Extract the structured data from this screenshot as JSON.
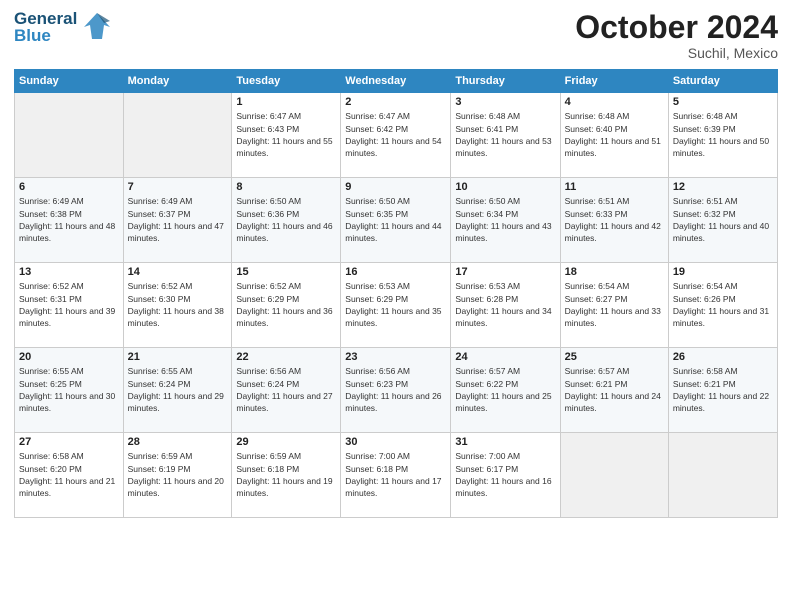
{
  "header": {
    "logo_line1": "General",
    "logo_line2": "Blue",
    "month": "October 2024",
    "location": "Suchil, Mexico"
  },
  "weekdays": [
    "Sunday",
    "Monday",
    "Tuesday",
    "Wednesday",
    "Thursday",
    "Friday",
    "Saturday"
  ],
  "weeks": [
    [
      {
        "day": "",
        "info": ""
      },
      {
        "day": "",
        "info": ""
      },
      {
        "day": "1",
        "info": "Sunrise: 6:47 AM\nSunset: 6:43 PM\nDaylight: 11 hours and 55 minutes."
      },
      {
        "day": "2",
        "info": "Sunrise: 6:47 AM\nSunset: 6:42 PM\nDaylight: 11 hours and 54 minutes."
      },
      {
        "day": "3",
        "info": "Sunrise: 6:48 AM\nSunset: 6:41 PM\nDaylight: 11 hours and 53 minutes."
      },
      {
        "day": "4",
        "info": "Sunrise: 6:48 AM\nSunset: 6:40 PM\nDaylight: 11 hours and 51 minutes."
      },
      {
        "day": "5",
        "info": "Sunrise: 6:48 AM\nSunset: 6:39 PM\nDaylight: 11 hours and 50 minutes."
      }
    ],
    [
      {
        "day": "6",
        "info": "Sunrise: 6:49 AM\nSunset: 6:38 PM\nDaylight: 11 hours and 48 minutes."
      },
      {
        "day": "7",
        "info": "Sunrise: 6:49 AM\nSunset: 6:37 PM\nDaylight: 11 hours and 47 minutes."
      },
      {
        "day": "8",
        "info": "Sunrise: 6:50 AM\nSunset: 6:36 PM\nDaylight: 11 hours and 46 minutes."
      },
      {
        "day": "9",
        "info": "Sunrise: 6:50 AM\nSunset: 6:35 PM\nDaylight: 11 hours and 44 minutes."
      },
      {
        "day": "10",
        "info": "Sunrise: 6:50 AM\nSunset: 6:34 PM\nDaylight: 11 hours and 43 minutes."
      },
      {
        "day": "11",
        "info": "Sunrise: 6:51 AM\nSunset: 6:33 PM\nDaylight: 11 hours and 42 minutes."
      },
      {
        "day": "12",
        "info": "Sunrise: 6:51 AM\nSunset: 6:32 PM\nDaylight: 11 hours and 40 minutes."
      }
    ],
    [
      {
        "day": "13",
        "info": "Sunrise: 6:52 AM\nSunset: 6:31 PM\nDaylight: 11 hours and 39 minutes."
      },
      {
        "day": "14",
        "info": "Sunrise: 6:52 AM\nSunset: 6:30 PM\nDaylight: 11 hours and 38 minutes."
      },
      {
        "day": "15",
        "info": "Sunrise: 6:52 AM\nSunset: 6:29 PM\nDaylight: 11 hours and 36 minutes."
      },
      {
        "day": "16",
        "info": "Sunrise: 6:53 AM\nSunset: 6:29 PM\nDaylight: 11 hours and 35 minutes."
      },
      {
        "day": "17",
        "info": "Sunrise: 6:53 AM\nSunset: 6:28 PM\nDaylight: 11 hours and 34 minutes."
      },
      {
        "day": "18",
        "info": "Sunrise: 6:54 AM\nSunset: 6:27 PM\nDaylight: 11 hours and 33 minutes."
      },
      {
        "day": "19",
        "info": "Sunrise: 6:54 AM\nSunset: 6:26 PM\nDaylight: 11 hours and 31 minutes."
      }
    ],
    [
      {
        "day": "20",
        "info": "Sunrise: 6:55 AM\nSunset: 6:25 PM\nDaylight: 11 hours and 30 minutes."
      },
      {
        "day": "21",
        "info": "Sunrise: 6:55 AM\nSunset: 6:24 PM\nDaylight: 11 hours and 29 minutes."
      },
      {
        "day": "22",
        "info": "Sunrise: 6:56 AM\nSunset: 6:24 PM\nDaylight: 11 hours and 27 minutes."
      },
      {
        "day": "23",
        "info": "Sunrise: 6:56 AM\nSunset: 6:23 PM\nDaylight: 11 hours and 26 minutes."
      },
      {
        "day": "24",
        "info": "Sunrise: 6:57 AM\nSunset: 6:22 PM\nDaylight: 11 hours and 25 minutes."
      },
      {
        "day": "25",
        "info": "Sunrise: 6:57 AM\nSunset: 6:21 PM\nDaylight: 11 hours and 24 minutes."
      },
      {
        "day": "26",
        "info": "Sunrise: 6:58 AM\nSunset: 6:21 PM\nDaylight: 11 hours and 22 minutes."
      }
    ],
    [
      {
        "day": "27",
        "info": "Sunrise: 6:58 AM\nSunset: 6:20 PM\nDaylight: 11 hours and 21 minutes."
      },
      {
        "day": "28",
        "info": "Sunrise: 6:59 AM\nSunset: 6:19 PM\nDaylight: 11 hours and 20 minutes."
      },
      {
        "day": "29",
        "info": "Sunrise: 6:59 AM\nSunset: 6:18 PM\nDaylight: 11 hours and 19 minutes."
      },
      {
        "day": "30",
        "info": "Sunrise: 7:00 AM\nSunset: 6:18 PM\nDaylight: 11 hours and 17 minutes."
      },
      {
        "day": "31",
        "info": "Sunrise: 7:00 AM\nSunset: 6:17 PM\nDaylight: 11 hours and 16 minutes."
      },
      {
        "day": "",
        "info": ""
      },
      {
        "day": "",
        "info": ""
      }
    ]
  ]
}
